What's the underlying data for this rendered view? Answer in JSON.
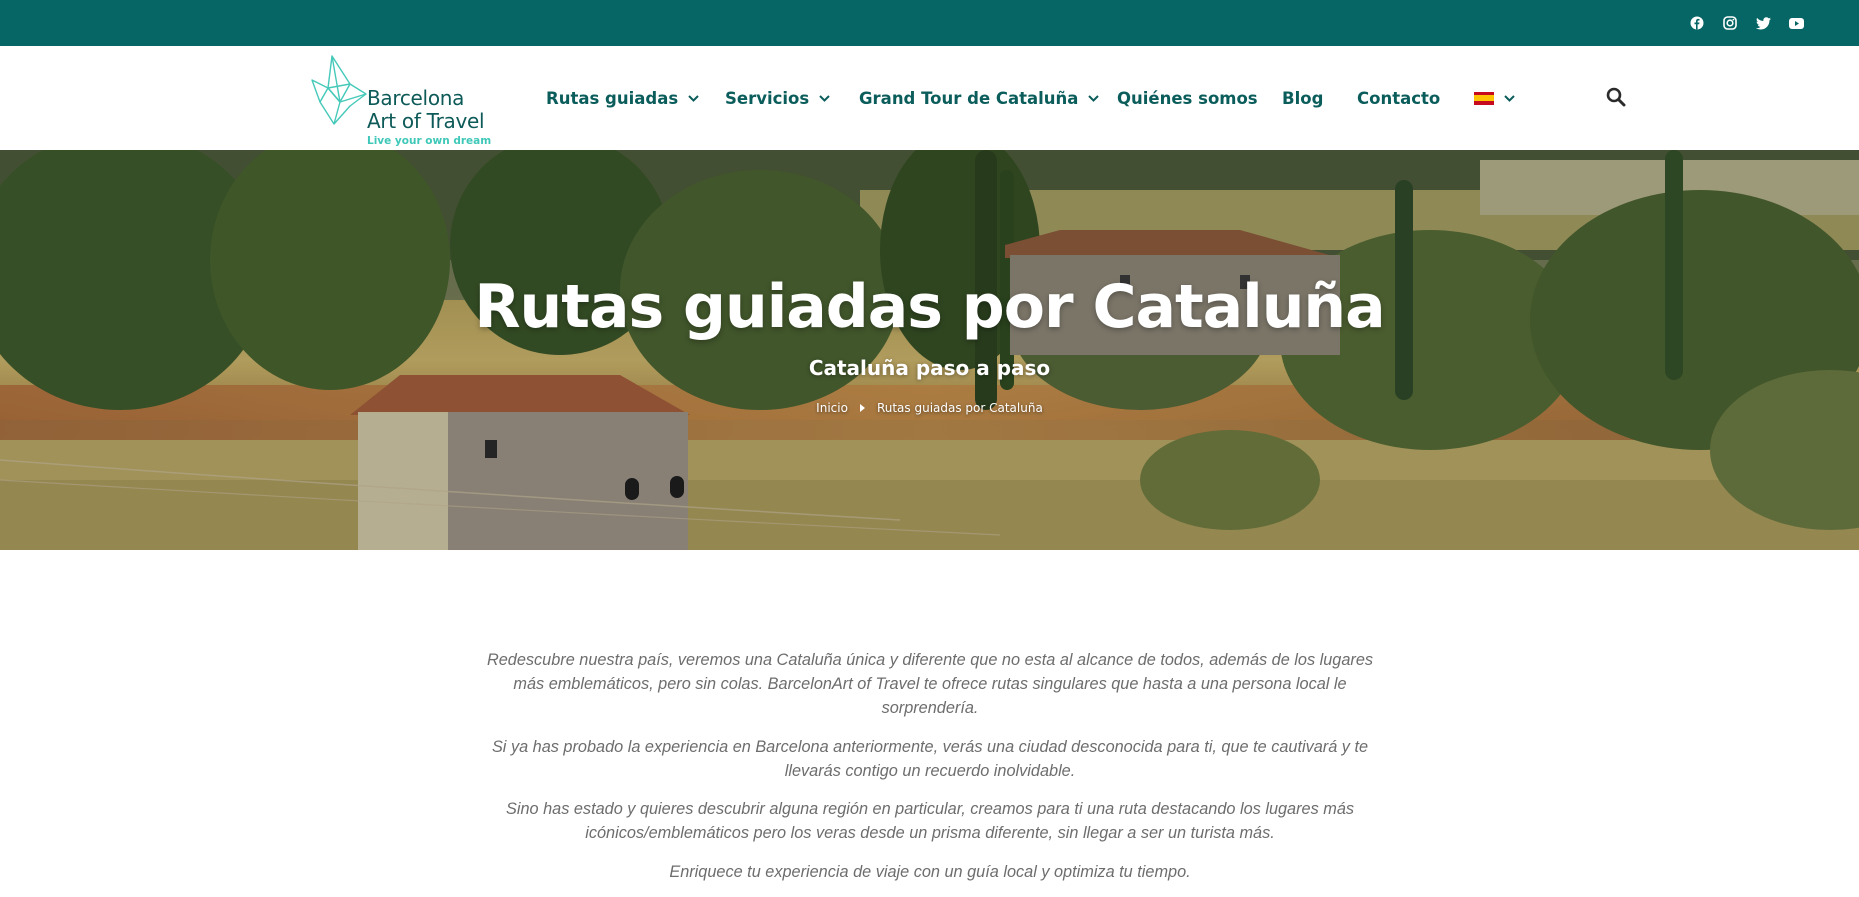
{
  "topbar": {
    "background": "#066665",
    "social_icons": [
      "facebook-icon",
      "instagram-icon",
      "twitter-icon",
      "youtube-icon"
    ]
  },
  "header": {
    "logo": {
      "line1": "Barcelona",
      "line2": "Art of Travel",
      "tagline": "Live your own dream"
    },
    "nav": [
      {
        "label": "Rutas guiadas",
        "has_dropdown": true
      },
      {
        "label": "Servicios",
        "has_dropdown": true
      },
      {
        "label": "Grand Tour de Cataluña",
        "has_dropdown": true
      },
      {
        "label": "Quiénes somos",
        "has_dropdown": false
      },
      {
        "label": "Blog",
        "has_dropdown": false
      },
      {
        "label": "Contacto",
        "has_dropdown": false
      }
    ],
    "language": {
      "icon": "spain-flag-icon",
      "has_dropdown": true
    },
    "search_icon": "search-icon"
  },
  "hero": {
    "title": "Rutas guiadas por Cataluña",
    "subtitle": "Cataluña paso a paso",
    "breadcrumb": {
      "home": "Inicio",
      "current": "Rutas guiadas por Cataluña"
    }
  },
  "content": {
    "paragraphs": [
      "Redescubre nuestra país, veremos una Cataluña única y diferente que no esta al alcance de todos, además de los lugares más emblemáticos, pero sin colas. BarcelonArt of Travel te ofrece rutas singulares que hasta a una persona local le sorprendería.",
      "Si ya has probado la experiencia en Barcelona anteriormente, verás una ciudad desconocida para ti, que te cautivará y te llevarás contigo un recuerdo inolvidable.",
      "Sino has estado y quieres descubrir alguna región en particular, creamos para ti una ruta destacando los lugares más icónicos/emblemáticos pero los veras desde un prisma diferente, sin llegar a ser un turista más.",
      "Enriquece tu experiencia de viaje con un guía local y optimiza tu tiempo."
    ]
  },
  "colors": {
    "brand_dark_teal": "#066665",
    "nav_text": "#0b5d5b",
    "logo_accent": "#3fc8b8",
    "body_text": "#6d6d6d"
  }
}
